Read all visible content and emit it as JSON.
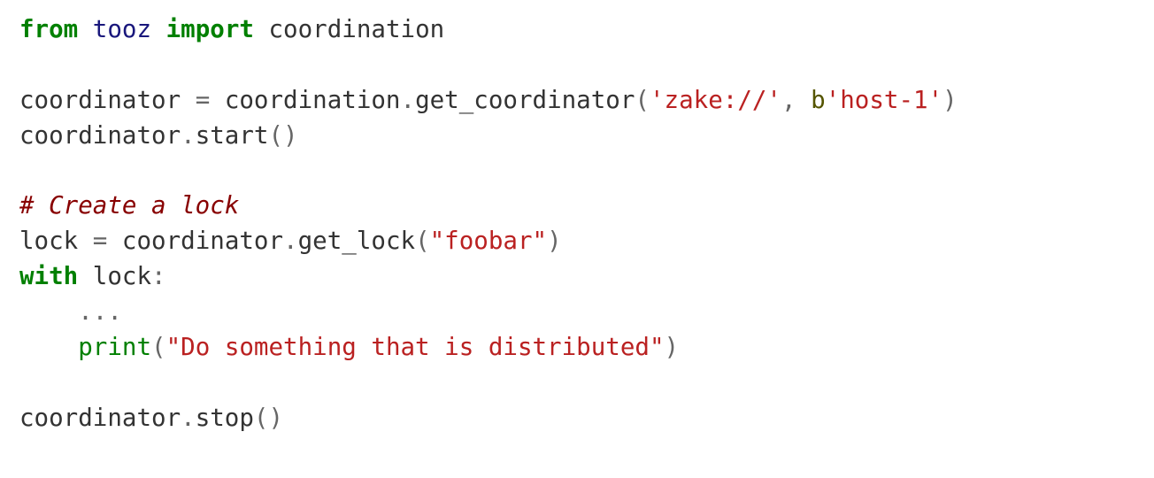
{
  "code": {
    "l1": {
      "kw_from": "from",
      "mod": "tooz",
      "kw_import": "import",
      "name": "coordination"
    },
    "l3": {
      "var": "coordinator",
      "eq": "=",
      "mod": "coordination",
      "dot": ".",
      "fn": "get_coordinator",
      "lp": "(",
      "arg1": "'zake://'",
      "comma": ",",
      "prefix": "b",
      "arg2": "'host-1'",
      "rp": ")"
    },
    "l4": {
      "var": "coordinator",
      "dot": ".",
      "fn": "start",
      "lp": "(",
      "rp": ")"
    },
    "l6": {
      "comment": "# Create a lock"
    },
    "l7": {
      "var": "lock",
      "eq": "=",
      "obj": "coordinator",
      "dot": ".",
      "fn": "get_lock",
      "lp": "(",
      "arg": "\"foobar\"",
      "rp": ")"
    },
    "l8": {
      "kw_with": "with",
      "var": "lock",
      "colon": ":"
    },
    "l9": {
      "ellipsis": "..."
    },
    "l10": {
      "fn": "print",
      "lp": "(",
      "arg": "\"Do something that is distributed\"",
      "rp": ")"
    },
    "l12": {
      "var": "coordinator",
      "dot": ".",
      "fn": "stop",
      "lp": "(",
      "rp": ")"
    }
  }
}
